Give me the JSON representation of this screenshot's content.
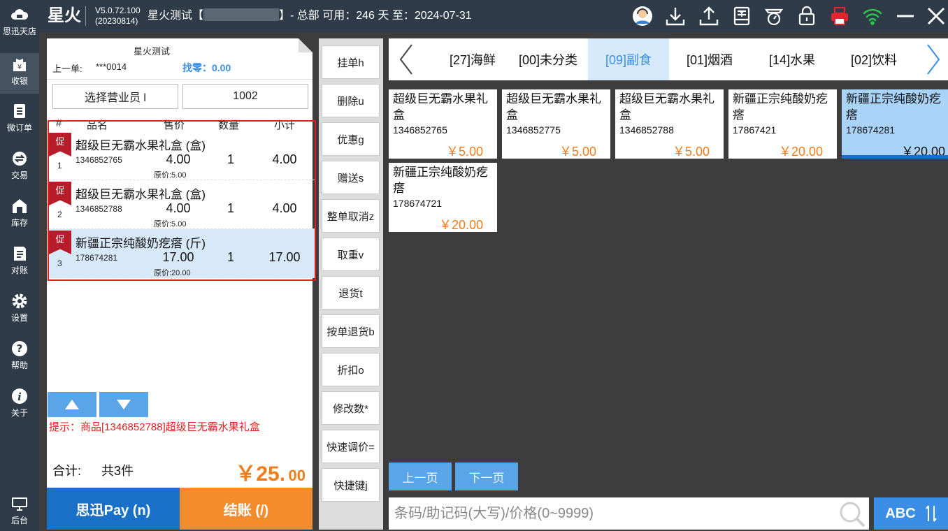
{
  "sidebar": {
    "items": [
      {
        "label": "思迅天店",
        "icon": "cloud-shop-icon"
      },
      {
        "label": "收银",
        "icon": "cashier-icon"
      },
      {
        "label": "微订单",
        "icon": "order-icon"
      },
      {
        "label": "交易",
        "icon": "transaction-icon"
      },
      {
        "label": "库存",
        "icon": "inventory-icon"
      },
      {
        "label": "对账",
        "icon": "reconcile-icon"
      },
      {
        "label": "设置",
        "icon": "gear-icon"
      },
      {
        "label": "帮助",
        "icon": "help-icon"
      },
      {
        "label": "关于",
        "icon": "info-icon"
      },
      {
        "label": "后台",
        "icon": "monitor-icon"
      }
    ]
  },
  "header": {
    "brand": "星火",
    "version": "V5.0.72.100",
    "build": "(20230814)",
    "store_prefix": "星火测试【",
    "store_suffix": "】- 总部 可用：246 天 至：2024-07-31",
    "icons": [
      "avatar-icon",
      "download-icon",
      "upload-icon",
      "cash-drawer-icon",
      "scale-icon",
      "lock-icon",
      "printer-icon",
      "wifi-icon",
      "minimize-icon",
      "close-icon"
    ]
  },
  "cart": {
    "store": "星火测试",
    "prev_label": "上一单:",
    "prev_value": "***0014",
    "change": "找零：0.00",
    "clerk_button": "选择营业员 l",
    "clerk_id": "1002",
    "columns": {
      "num": "#",
      "name": "品名",
      "price": "售价",
      "qty": "数量",
      "subtotal": "小计"
    },
    "rows": [
      {
        "tag": "促",
        "idx": "1",
        "name": "超级巨无霸水果礼盒 (盒)",
        "code": "1346852765",
        "price": "4.00",
        "qty": "1",
        "subtotal": "4.00",
        "orig": "原价:5.00"
      },
      {
        "tag": "促",
        "idx": "2",
        "name": "超级巨无霸水果礼盒 (盒)",
        "code": "1346852788",
        "price": "4.00",
        "qty": "1",
        "subtotal": "4.00",
        "orig": "原价:5.00"
      },
      {
        "tag": "促",
        "idx": "3",
        "name": "新疆正宗纯酸奶疙瘩 (斤)",
        "code": "178674281",
        "price": "17.00",
        "qty": "1",
        "subtotal": "17.00",
        "orig": "原价:20.00"
      }
    ],
    "hint": "提示：商品[1346852788]超级巨无霸水果礼盒",
    "total_label": "合计:",
    "total_count": "共3件",
    "total_symbol": "￥",
    "total_int": "25.",
    "total_dec": "00",
    "pay_button": "思迅Pay (n)",
    "checkout_button": "结账 (/)"
  },
  "functions": [
    "挂单h",
    "删除u",
    "优惠g",
    "赠送s",
    "整单取消z",
    "取重v",
    "退货t",
    "按单退货b",
    "折扣o",
    "修改数*",
    "快速调价=",
    "快捷键j"
  ],
  "categories": [
    {
      "label": "[27]海鲜",
      "active": false
    },
    {
      "label": "[00]未分类",
      "active": false
    },
    {
      "label": "[09]副食",
      "active": true
    },
    {
      "label": "[01]烟酒",
      "active": false
    },
    {
      "label": "[14]水果",
      "active": false
    },
    {
      "label": "[02]饮料",
      "active": false
    }
  ],
  "products": [
    {
      "name": "超级巨无霸水果礼盒",
      "code": "1346852765",
      "price": "￥5.00"
    },
    {
      "name": "超级巨无霸水果礼盒",
      "code": "1346852775",
      "price": "￥5.00"
    },
    {
      "name": "超级巨无霸水果礼盒",
      "code": "1346852788",
      "price": "￥5.00"
    },
    {
      "name": "新疆正宗纯酸奶疙瘩",
      "code": "17867421",
      "price": "￥20.00"
    },
    {
      "name": "新疆正宗纯酸奶疙瘩",
      "code": "178674281",
      "price": "￥20.00"
    },
    {
      "name": "新疆正宗纯酸奶疙瘩",
      "code": "178674721",
      "price": "￥20.00"
    }
  ],
  "paging": {
    "prev": "上一页",
    "next": "下一页"
  },
  "search": {
    "placeholder": "条码/助记码(大写)/价格(0~9999)"
  },
  "keyboard_button": "ABC",
  "colors": {
    "accent": "#3a8ee6",
    "price": "#f07d1a",
    "promo": "#b71c2b",
    "pay": "#1a6fc7",
    "checkout": "#f48c2e"
  }
}
